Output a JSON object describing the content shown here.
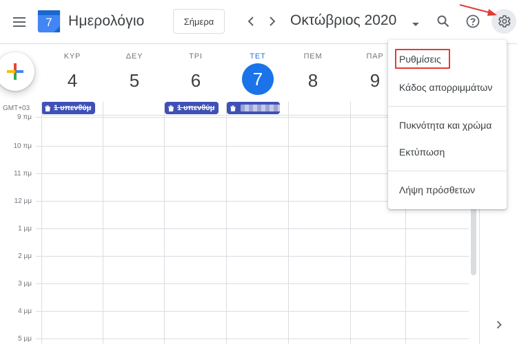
{
  "header": {
    "app_title": "Ημερολόγιο",
    "logo_day": "7",
    "today_label": "Σήμερα",
    "month_title": "Οκτώβριος 2020"
  },
  "icons": {
    "menu": "hamburger-menu-icon",
    "prev": "chevron-left-icon",
    "next": "chevron-right-icon",
    "caret": "caret-down-icon",
    "search": "search-icon",
    "help": "help-icon",
    "settings": "gear-icon",
    "create": "plus-icon",
    "side": "chevron-right-icon"
  },
  "days": [
    {
      "name": "ΚΥΡ",
      "num": "4"
    },
    {
      "name": "ΔΕΥ",
      "num": "5"
    },
    {
      "name": "ΤΡΙ",
      "num": "6"
    },
    {
      "name": "ΤΕΤ",
      "num": "7"
    },
    {
      "name": "ΠΕΜ",
      "num": "8"
    },
    {
      "name": "ΠΑΡ",
      "num": "9"
    }
  ],
  "timezone": "GMT+03",
  "allday_events": [
    {
      "label": "1 υπενθύμ"
    },
    {
      "label": "1 υπενθύμ"
    }
  ],
  "hours": [
    "9 πμ",
    "10 πμ",
    "11 πμ",
    "12 μμ",
    "1 μμ",
    "2 μμ",
    "3 μμ",
    "4 μμ",
    "5 μμ"
  ],
  "settings_menu": {
    "items": [
      "Ρυθμίσεις",
      "Κάδος απορριμμάτων",
      "Πυκνότητα και χρώμα",
      "Εκτύπωση",
      "Λήψη πρόσθετων"
    ]
  },
  "colors": {
    "accent": "#1a73e8",
    "event": "#3f51b5",
    "annotation": "#e53935"
  }
}
